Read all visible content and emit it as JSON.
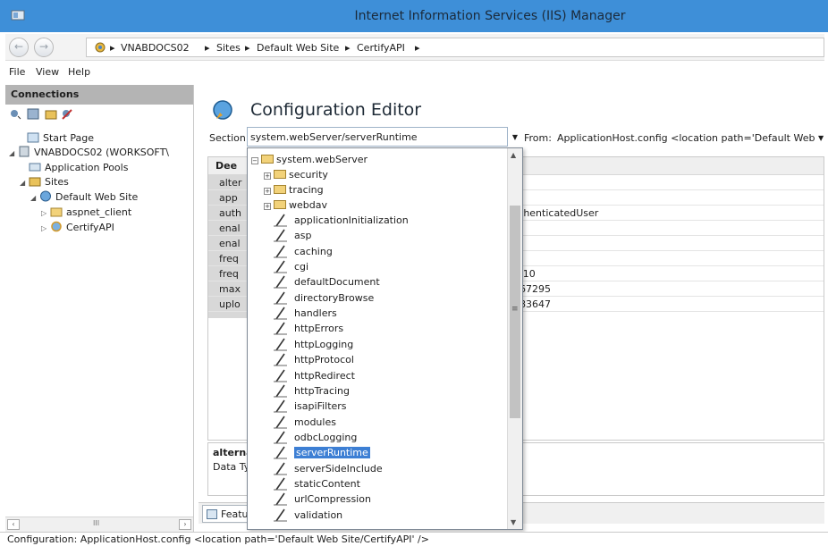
{
  "window": {
    "title": "Internet Information Services (IIS) Manager",
    "app_icon": "iis-icon"
  },
  "address": {
    "back_glyph": "←",
    "forward_glyph": "→",
    "breadcrumbs": [
      "VNABDOCS02",
      "Sites",
      "Default Web Site",
      "CertifyAPI"
    ],
    "separator": "▸"
  },
  "menu": {
    "items": [
      "File",
      "View",
      "Help"
    ]
  },
  "connections": {
    "header": "Connections",
    "tree": [
      {
        "label": "Start Page",
        "icon": "start-page-icon"
      },
      {
        "label": "VNABDOCS02 (WORKSOFT\\",
        "icon": "server-icon"
      },
      {
        "label": "Application Pools",
        "icon": "app-pools-icon"
      },
      {
        "label": "Sites",
        "icon": "sites-folder-icon"
      },
      {
        "label": "Default Web Site",
        "icon": "globe-icon"
      },
      {
        "label": "aspnet_client",
        "icon": "folder-icon"
      },
      {
        "label": "CertifyAPI",
        "icon": "application-icon"
      }
    ],
    "scroll_grip": "III"
  },
  "editor": {
    "title": "Configuration Editor",
    "section_label": "Section:",
    "section_value": "system.webServer/serverRuntime",
    "from_label": "From:",
    "from_value": "ApplicationHost.config <location path='Default Web",
    "grid_header": "Dee",
    "rows": [
      {
        "name": "alter",
        "value": ""
      },
      {
        "name": "app",
        "value": ""
      },
      {
        "name": "auth",
        "value": "thenticatedUser"
      },
      {
        "name": "enal",
        "value": ""
      },
      {
        "name": "enal",
        "value": ""
      },
      {
        "name": "freq",
        "value": ""
      },
      {
        "name": "freq",
        "value": ":10"
      },
      {
        "name": "max",
        "value": "67295"
      },
      {
        "name": "uplo",
        "value": "83647"
      }
    ],
    "desc_title": "alternat",
    "desc_type": "Data Ty",
    "bottom_tab": "Featur"
  },
  "section_dropdown": {
    "root": "system.webServer",
    "items": [
      {
        "label": "security",
        "kind": "folder"
      },
      {
        "label": "tracing",
        "kind": "folder"
      },
      {
        "label": "webdav",
        "kind": "folder"
      },
      {
        "label": "applicationInitialization",
        "kind": "section"
      },
      {
        "label": "asp",
        "kind": "section"
      },
      {
        "label": "caching",
        "kind": "section"
      },
      {
        "label": "cgi",
        "kind": "section"
      },
      {
        "label": "defaultDocument",
        "kind": "section"
      },
      {
        "label": "directoryBrowse",
        "kind": "section"
      },
      {
        "label": "handlers",
        "kind": "section"
      },
      {
        "label": "httpErrors",
        "kind": "section"
      },
      {
        "label": "httpLogging",
        "kind": "section"
      },
      {
        "label": "httpProtocol",
        "kind": "section"
      },
      {
        "label": "httpRedirect",
        "kind": "section"
      },
      {
        "label": "httpTracing",
        "kind": "section"
      },
      {
        "label": "isapiFilters",
        "kind": "section"
      },
      {
        "label": "modules",
        "kind": "section"
      },
      {
        "label": "odbcLogging",
        "kind": "section"
      },
      {
        "label": "serverRuntime",
        "kind": "section",
        "selected": true
      },
      {
        "label": "serverSideInclude",
        "kind": "section"
      },
      {
        "label": "staticContent",
        "kind": "section"
      },
      {
        "label": "urlCompression",
        "kind": "section"
      },
      {
        "label": "validation",
        "kind": "section"
      }
    ]
  },
  "status": {
    "text": "Configuration: ApplicationHost.config <location path='Default Web Site/CertifyAPI' />"
  },
  "colors": {
    "titlebar": "#3e8fd8",
    "selection": "#3d7fd4",
    "header_gray": "#b4b4b4"
  }
}
